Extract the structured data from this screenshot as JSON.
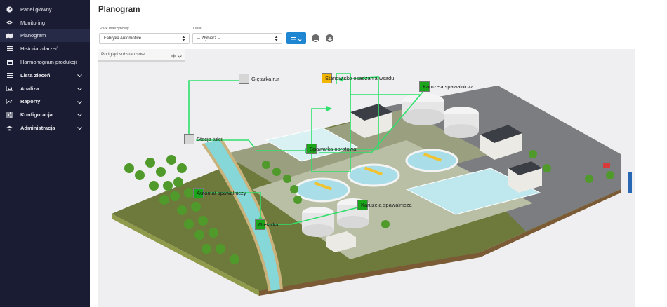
{
  "sidebar": {
    "items": [
      {
        "label": "Panel główny",
        "icon": "gauge-icon",
        "expandable": false
      },
      {
        "label": "Monitoring",
        "icon": "eye-icon",
        "expandable": false
      },
      {
        "label": "Planogram",
        "icon": "map-icon",
        "expandable": false,
        "active": true
      },
      {
        "label": "Historia zdarzeń",
        "icon": "list-icon",
        "expandable": false
      },
      {
        "label": "Harmonogram produkcji",
        "icon": "calendar-icon",
        "expandable": false
      },
      {
        "label": "Lista zleceń",
        "icon": "list-icon",
        "expandable": true
      },
      {
        "label": "Analiza",
        "icon": "chart-area-icon",
        "expandable": true
      },
      {
        "label": "Raporty",
        "icon": "chart-line-icon",
        "expandable": true
      },
      {
        "label": "Konfiguracja",
        "icon": "sliders-icon",
        "expandable": true
      },
      {
        "label": "Administracja",
        "icon": "users-icon",
        "expandable": true
      }
    ]
  },
  "header": {
    "title": "Planogram"
  },
  "filters": {
    "park_label": "Park maszynowy",
    "park_value": "Fabryka Automotive",
    "line_label": "Linia",
    "line_value": "-- Wybierz --"
  },
  "substatus": {
    "label": "Podgląd substatusów"
  },
  "nodes": {
    "gietarka_rur": "Giętarka rur",
    "stanowisko": "Stanowisko osadzania wsadu",
    "karuzela_top": "Karuzela spawalnicza",
    "stacja": "Stacja tulei",
    "spawarka": "Spawarka obrotowa",
    "automat": "Automat spawalniczy",
    "karuzela_bottom": "Karuzela spawalnicza",
    "gietarka": "Giętarka"
  },
  "colors": {
    "sidebar_bg": "#1a1c33",
    "accent": "#1f86d1",
    "status_running": "#1aa51a",
    "status_warning": "#f2b600",
    "status_idle": "#d6d6d6",
    "connector": "#2ee06a"
  }
}
